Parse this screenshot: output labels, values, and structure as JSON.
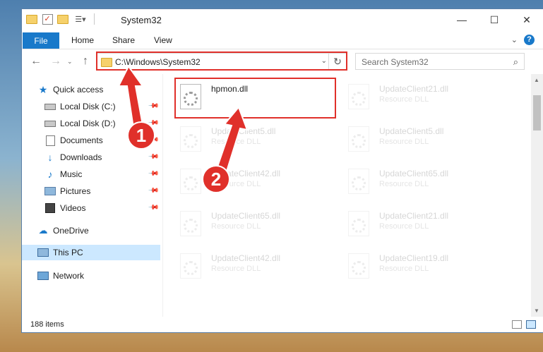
{
  "window": {
    "title": "System32",
    "controls": {
      "minimize": "—",
      "maximize": "☐",
      "close": "✕"
    }
  },
  "ribbon": {
    "tabs": [
      {
        "label": "File"
      },
      {
        "label": "Home"
      },
      {
        "label": "Share"
      },
      {
        "label": "View"
      }
    ],
    "expand_icon": "chevron-down-icon",
    "help_label": "?"
  },
  "navigation": {
    "back_icon": "arrow-left-icon",
    "forward_icon": "arrow-right-icon",
    "recent_icon": "chevron-down-icon",
    "up_icon": "arrow-up-icon",
    "address": "C:\\Windows\\System32",
    "search_placeholder": "Search System32"
  },
  "sidebar": {
    "items": [
      {
        "label": "Quick access",
        "icon": "star-icon",
        "pinned": false
      },
      {
        "label": "Local Disk (C:)",
        "icon": "drive-icon",
        "pinned": true
      },
      {
        "label": "Local Disk (D:)",
        "icon": "drive-icon",
        "pinned": true
      },
      {
        "label": "Documents",
        "icon": "document-icon",
        "pinned": true
      },
      {
        "label": "Downloads",
        "icon": "download-icon",
        "pinned": true
      },
      {
        "label": "Music",
        "icon": "music-icon",
        "pinned": true
      },
      {
        "label": "Pictures",
        "icon": "pictures-icon",
        "pinned": true
      },
      {
        "label": "Videos",
        "icon": "videos-icon",
        "pinned": true
      },
      {
        "label": "OneDrive",
        "icon": "cloud-icon",
        "pinned": false
      },
      {
        "label": "This PC",
        "icon": "computer-icon",
        "pinned": false,
        "selected": true
      },
      {
        "label": "Network",
        "icon": "network-icon",
        "pinned": false
      }
    ]
  },
  "files": [
    {
      "name": "hpmon.dll",
      "type": "",
      "highlighted": true
    },
    {
      "name": "UpdateClient21.dll",
      "type": "Resource DLL"
    },
    {
      "name": "UpdateClient5.dll",
      "type": "Resource DLL"
    },
    {
      "name": "UpdateClient5.dll",
      "type": "Resource DLL"
    },
    {
      "name": "UpdateClient42.dll",
      "type": "Resource DLL"
    },
    {
      "name": "UpdateClient65.dll",
      "type": "Resource DLL"
    },
    {
      "name": "UpdateClient65.dll",
      "type": "Resource DLL"
    },
    {
      "name": "UpdateClient21.dll",
      "type": "Resource DLL"
    },
    {
      "name": "UpdateClient42.dll",
      "type": "Resource DLL"
    },
    {
      "name": "UpdateClient19.dll",
      "type": "Resource DLL"
    }
  ],
  "status": {
    "item_count": "188 items"
  },
  "annotations": {
    "step1": "1",
    "step2": "2",
    "color": "#e0302a"
  }
}
